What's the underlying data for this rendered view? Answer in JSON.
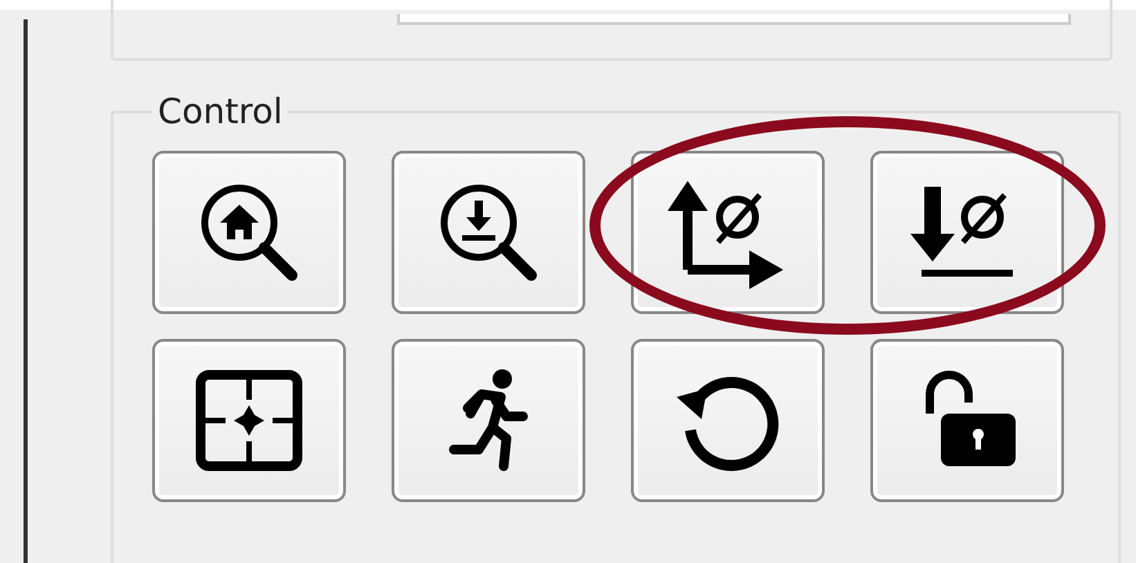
{
  "control": {
    "title": "Control",
    "rows": [
      {
        "groups": [
          {
            "circled": false,
            "buttons": [
              {
                "kind": "zoom-home"
              },
              {
                "kind": "zoom-down"
              }
            ]
          },
          {
            "circled": true,
            "buttons": [
              {
                "kind": "axis-zero"
              },
              {
                "kind": "down-zero"
              }
            ]
          }
        ]
      },
      {
        "groups": [
          {
            "circled": false,
            "buttons": [
              {
                "kind": "target"
              },
              {
                "kind": "run"
              }
            ]
          },
          {
            "circled": false,
            "buttons": [
              {
                "kind": "reset"
              },
              {
                "kind": "unlock"
              }
            ]
          }
        ]
      }
    ]
  }
}
